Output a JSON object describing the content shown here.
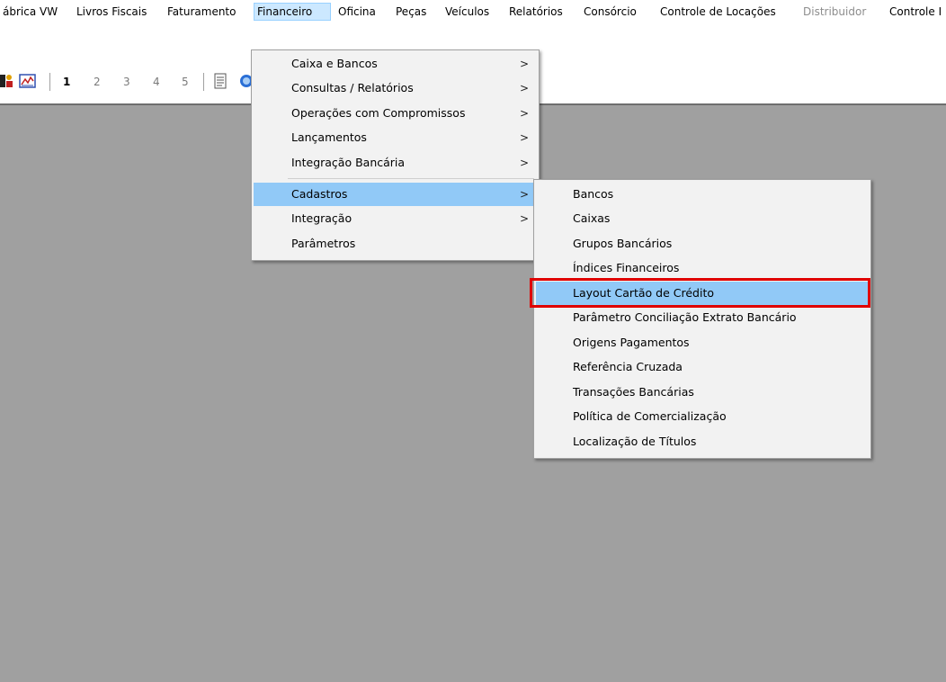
{
  "menubar": {
    "items": [
      {
        "label": "ábrica VW"
      },
      {
        "label": "Livros Fiscais"
      },
      {
        "label": "Faturamento"
      },
      {
        "label": "Financeiro"
      },
      {
        "label": "Oficina"
      },
      {
        "label": "Peças"
      },
      {
        "label": "Veículos"
      },
      {
        "label": "Relatórios"
      },
      {
        "label": "Consórcio"
      },
      {
        "label": "Controle de Locações"
      },
      {
        "label": "Distribuidor"
      },
      {
        "label": "Controle I"
      }
    ],
    "active_item": "Financeiro",
    "disabled_item": "Distribuidor"
  },
  "toolbar": {
    "pages": [
      "1",
      "2",
      "3",
      "4",
      "5"
    ],
    "icons": [
      "person-icon",
      "chart-icon",
      "document-icon",
      "info-icon"
    ]
  },
  "financeiro_menu": {
    "items": [
      {
        "label": "Caixa e Bancos",
        "arrow": ">"
      },
      {
        "label": "Consultas / Relatórios",
        "arrow": ">"
      },
      {
        "label": "Operações com Compromissos",
        "arrow": ">"
      },
      {
        "label": "Lançamentos",
        "arrow": ">"
      },
      {
        "label": "Integração Bancária",
        "arrow": ">"
      },
      {
        "label": "Cadastros",
        "arrow": ">"
      },
      {
        "label": "Integração",
        "arrow": ">"
      },
      {
        "label": "Parâmetros",
        "arrow": ""
      }
    ],
    "highlighted": "Cadastros"
  },
  "cadastros_menu": {
    "items": [
      {
        "label": "Bancos"
      },
      {
        "label": "Caixas"
      },
      {
        "label": "Grupos Bancários"
      },
      {
        "label": "Índices Financeiros"
      },
      {
        "label": "Layout Cartão de Crédito"
      },
      {
        "label": "Parâmetro Conciliação Extrato Bancário"
      },
      {
        "label": "Origens Pagamentos"
      },
      {
        "label": "Referência Cruzada"
      },
      {
        "label": "Transações Bancárias"
      },
      {
        "label": "Política de Comercialização"
      },
      {
        "label": "Localização de Títulos"
      }
    ],
    "highlighted": "Layout Cartão de Crédito"
  },
  "colors": {
    "menu_highlight": "#91c9f7",
    "menubar_active_bg": "#cce8ff",
    "selection_box": "#e00000",
    "workspace": "#a0a0a0"
  }
}
